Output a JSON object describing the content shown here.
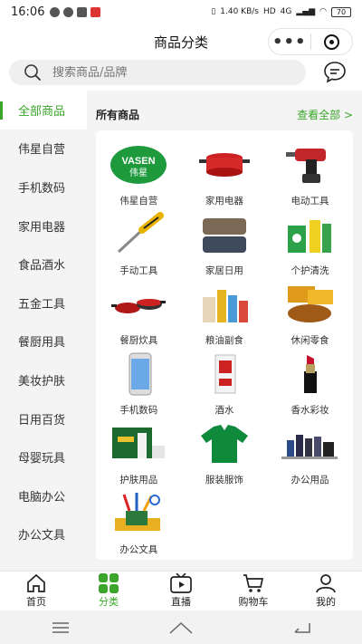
{
  "status": {
    "time": "16:06",
    "net": "1.40 KB/s",
    "hd": "HD",
    "sig": "4G",
    "battery": "70"
  },
  "header": {
    "title": "商品分类",
    "more_label": "•••"
  },
  "search": {
    "placeholder": "搜索商品/品牌"
  },
  "sidebar": {
    "items": [
      {
        "label": "全部商品"
      },
      {
        "label": "伟星自营"
      },
      {
        "label": "手机数码"
      },
      {
        "label": "家用电器"
      },
      {
        "label": "食品酒水"
      },
      {
        "label": "五金工具"
      },
      {
        "label": "餐厨用具"
      },
      {
        "label": "美妆护肤"
      },
      {
        "label": "日用百货"
      },
      {
        "label": "母婴玩具"
      },
      {
        "label": "电脑办公"
      },
      {
        "label": "办公文具"
      }
    ]
  },
  "content": {
    "title": "所有商品",
    "view_all": "查看全部 >",
    "items": [
      {
        "label": "伟星自营",
        "logo_line1": "VASEN",
        "logo_line2": "伟星"
      },
      {
        "label": "家用电器"
      },
      {
        "label": "电动工具"
      },
      {
        "label": "手动工具"
      },
      {
        "label": "家居日用"
      },
      {
        "label": "个护清洗"
      },
      {
        "label": "餐厨炊具"
      },
      {
        "label": "粮油副食"
      },
      {
        "label": "休闲零食"
      },
      {
        "label": "手机数码"
      },
      {
        "label": "酒水"
      },
      {
        "label": "香水彩妆"
      },
      {
        "label": "护肤用品"
      },
      {
        "label": "服装服饰"
      },
      {
        "label": "办公用品"
      },
      {
        "label": "办公文具"
      }
    ]
  },
  "tabbar": {
    "tabs": [
      {
        "label": "首页",
        "icon": "home-icon"
      },
      {
        "label": "分类",
        "icon": "category-icon"
      },
      {
        "label": "直播",
        "icon": "live-tv-icon"
      },
      {
        "label": "购物车",
        "icon": "cart-icon"
      },
      {
        "label": "我的",
        "icon": "user-icon"
      }
    ]
  },
  "colors": {
    "accent": "#3aa52a",
    "bg": "#f4f4f4"
  }
}
